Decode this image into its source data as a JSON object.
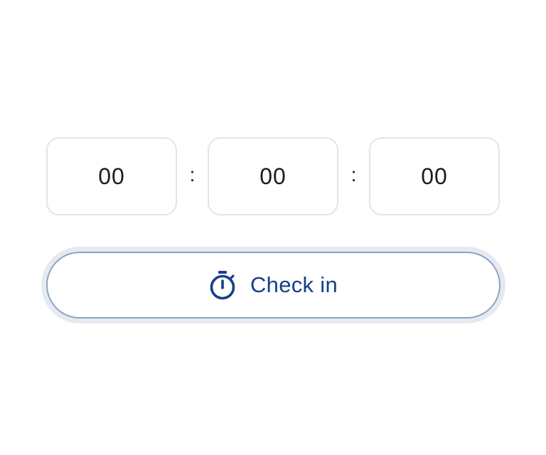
{
  "timer": {
    "hours": "00",
    "minutes": "00",
    "seconds": "00",
    "separator": ":"
  },
  "checkin": {
    "label": "Check in",
    "icon": "stopwatch-icon"
  },
  "colors": {
    "accent": "#14408a",
    "button_border": "#8aa4c8",
    "button_ring": "#e6eaf0",
    "box_border": "#e3e3ec",
    "text": "#1b1b24"
  }
}
